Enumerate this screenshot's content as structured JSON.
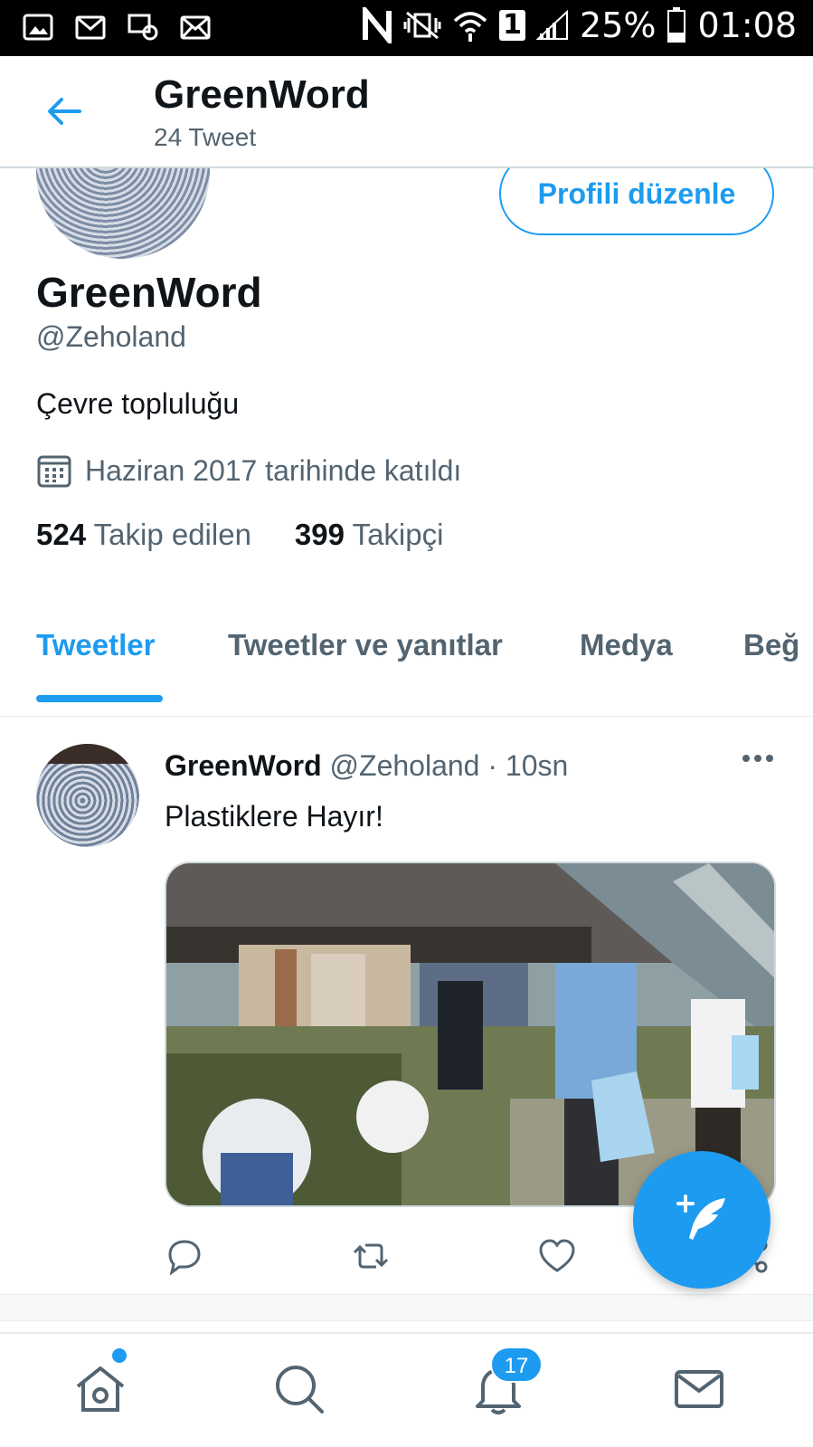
{
  "status_bar": {
    "battery": "25%",
    "time": "01:08",
    "sim_slot": "1",
    "left_icons": [
      "gallery-icon",
      "gmail-icon",
      "email-sync-icon",
      "mail-icon"
    ],
    "right_icons": [
      "nfc-icon",
      "vibrate-icon",
      "wifi-icon",
      "signal-icon",
      "battery-icon"
    ]
  },
  "header": {
    "title": "GreenWord",
    "subtitle": "24 Tweet"
  },
  "profile": {
    "edit_button": "Profili düzenle",
    "name": "GreenWord",
    "handle": "@Zeholand",
    "bio": "Çevre topluluğu",
    "joined": "Haziran 2017 tarihinde katıldı",
    "following_count": "524",
    "following_label": "Takip edilen",
    "followers_count": "399",
    "followers_label": "Takipçi"
  },
  "tabs": [
    {
      "label": "Tweetler",
      "active": true
    },
    {
      "label": "Tweetler ve yanıtlar",
      "active": false
    },
    {
      "label": "Medya",
      "active": false
    },
    {
      "label": "Beğ",
      "active": false
    }
  ],
  "tweet": {
    "name": "GreenWord",
    "meta": "@Zeholand · 10sn",
    "text": "Plastiklere Hayır!"
  },
  "bottom_nav": {
    "notifications_badge": "17"
  },
  "colors": {
    "accent": "#1d9bf0",
    "secondary_text": "#536471",
    "primary_text": "#0f1419",
    "divider": "#cfd9de"
  }
}
